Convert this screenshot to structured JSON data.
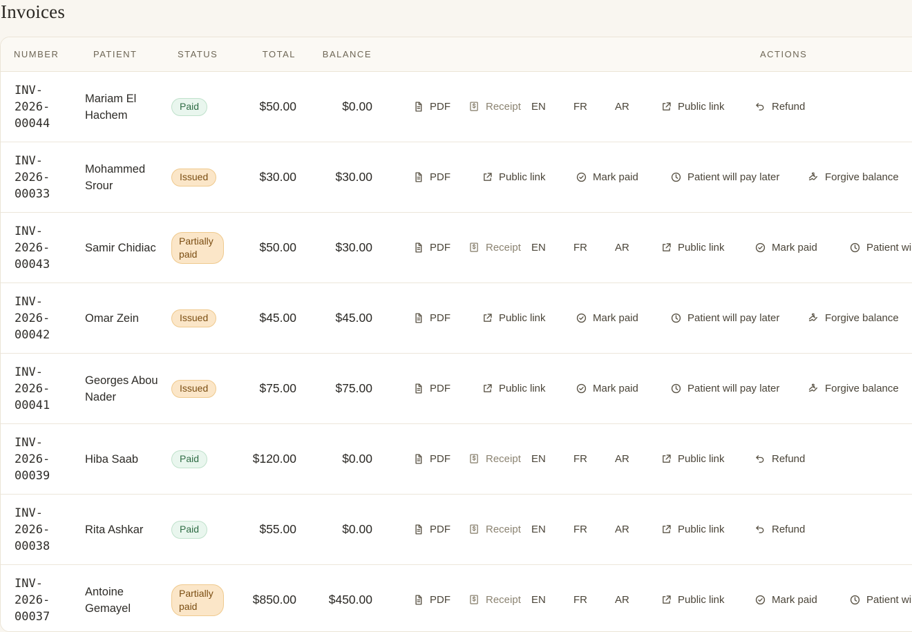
{
  "page": {
    "title": "Invoices"
  },
  "columns": {
    "number": "Number",
    "patient": "Patient",
    "status": "Status",
    "total": "Total",
    "balance": "Balance",
    "actions": "Actions"
  },
  "actions": {
    "pdf": "PDF",
    "receipt": "Receipt",
    "en": "EN",
    "fr": "FR",
    "ar": "AR",
    "public_link": "Public link",
    "refund": "Refund",
    "mark_paid": "Mark paid",
    "pay_later": "Patient will pay later",
    "pay_later_clipped": "Patient wil",
    "forgive": "Forgive balance"
  },
  "invoices": [
    {
      "number": "INV-\n2026-\n00044",
      "patient": "Mariam El Hachem",
      "status": "Paid",
      "status_kind": "paid",
      "total": "$50.00",
      "balance": "$0.00"
    },
    {
      "number": "INV-\n2026-\n00033",
      "patient": "Mohammed Srour",
      "status": "Issued",
      "status_kind": "issued",
      "total": "$30.00",
      "balance": "$30.00"
    },
    {
      "number": "INV-\n2026-\n00043",
      "patient": "Samir Chidiac",
      "status": "Partially paid",
      "status_kind": "partial",
      "total": "$50.00",
      "balance": "$30.00"
    },
    {
      "number": "INV-\n2026-\n00042",
      "patient": "Omar Zein",
      "status": "Issued",
      "status_kind": "issued",
      "total": "$45.00",
      "balance": "$45.00"
    },
    {
      "number": "INV-\n2026-\n00041",
      "patient": "Georges Abou Nader",
      "status": "Issued",
      "status_kind": "issued",
      "total": "$75.00",
      "balance": "$75.00"
    },
    {
      "number": "INV-\n2026-\n00039",
      "patient": "Hiba Saab",
      "status": "Paid",
      "status_kind": "paid",
      "total": "$120.00",
      "balance": "$0.00"
    },
    {
      "number": "INV-\n2026-\n00038",
      "patient": "Rita Ashkar",
      "status": "Paid",
      "status_kind": "paid",
      "total": "$55.00",
      "balance": "$0.00"
    },
    {
      "number": "INV-\n2026-\n00037",
      "patient": "Antoine Gemayel",
      "status": "Partially paid",
      "status_kind": "partial",
      "total": "$850.00",
      "balance": "$450.00"
    }
  ]
}
